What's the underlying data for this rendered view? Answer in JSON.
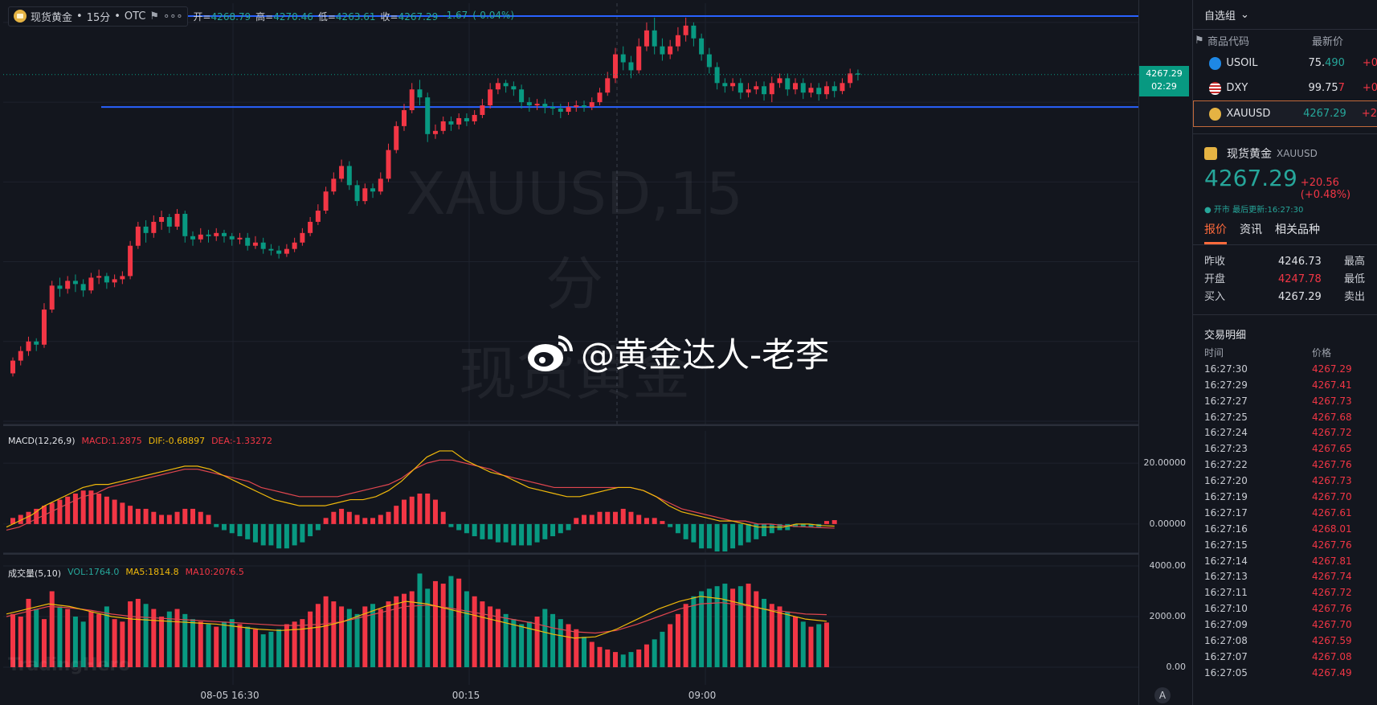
{
  "legend": {
    "symbol": "现货黄金",
    "interval": "15分",
    "exchange": "OTC",
    "more": "∘∘∘",
    "open_label": "开=",
    "open": "4268.79",
    "high_label": "高=",
    "high": "4270.46",
    "low_label": "低=",
    "low": "4263.61",
    "close_label": "收=",
    "close": "4267.29",
    "change": "-1.67",
    "change_pct": "(-0.04%)"
  },
  "price_tag": {
    "price": "4267.29",
    "countdown": "02:29"
  },
  "watermark": {
    "line1": "XAUUSD,15分",
    "line2": "现货黄金"
  },
  "weibo": {
    "handle": "@黄金达人-老李"
  },
  "brand": "TradingHero",
  "macd": {
    "title": "MACD(12,26,9)",
    "macd": "MACD:1.2875",
    "dif": "DIF:-0.68897",
    "dea": "DEA:-1.33272"
  },
  "vol": {
    "title": "成交量(5,10)",
    "vol": "VOL:1764.0",
    "ma5": "MA5:1814.8",
    "ma10": "MA10:2076.5"
  },
  "time_axis": [
    "08-05 16:30",
    "00:15",
    "09:00"
  ],
  "axis_button": "A",
  "watchlist": {
    "title": "自选组",
    "col_code": "商品代码",
    "col_price": "最新价",
    "rows": [
      {
        "code": "USOIL",
        "price_main": "75.",
        "price_tail": "490",
        "chg": "+0"
      },
      {
        "code": "DXY",
        "price_main": "99.75",
        "price_tail": "7",
        "chg": "+0"
      },
      {
        "code": "XAUUSD",
        "price_main": "4267.29",
        "price_tail": "",
        "chg": "+2"
      }
    ]
  },
  "symbol_info": {
    "name": "现货黄金",
    "code": "XAUUSD",
    "price": "4267.29",
    "change": "+20.56 (+0.48%)",
    "status": "● 开市 最后更新:16:27:30"
  },
  "tabs": [
    "报价",
    "资讯",
    "相关品种"
  ],
  "quotes": [
    {
      "label": "昨收",
      "value": "4246.73",
      "label2": "最高"
    },
    {
      "label": "开盘",
      "value": "4247.78",
      "label2": "最低"
    },
    {
      "label": "买入",
      "value": "4267.29",
      "label2": "卖出"
    }
  ],
  "trades": {
    "title": "交易明细",
    "col_time": "时间",
    "col_price": "价格",
    "rows": [
      [
        "16:27:30",
        "4267.29"
      ],
      [
        "16:27:29",
        "4267.41"
      ],
      [
        "16:27:27",
        "4267.73"
      ],
      [
        "16:27:25",
        "4267.68"
      ],
      [
        "16:27:24",
        "4267.72"
      ],
      [
        "16:27:23",
        "4267.65"
      ],
      [
        "16:27:22",
        "4267.76"
      ],
      [
        "16:27:20",
        "4267.73"
      ],
      [
        "16:27:19",
        "4267.70"
      ],
      [
        "16:27:17",
        "4267.61"
      ],
      [
        "16:27:16",
        "4268.01"
      ],
      [
        "16:27:15",
        "4267.76"
      ],
      [
        "16:27:14",
        "4267.81"
      ],
      [
        "16:27:13",
        "4267.74"
      ],
      [
        "16:27:11",
        "4267.72"
      ],
      [
        "16:27:10",
        "4267.76"
      ],
      [
        "16:27:09",
        "4267.70"
      ],
      [
        "16:27:08",
        "4267.59"
      ],
      [
        "16:27:07",
        "4267.08"
      ],
      [
        "16:27:05",
        "4267.49"
      ]
    ]
  },
  "chart_data": [
    {
      "type": "candlestick",
      "y_ticks": [
        "4300.00",
        "4250.00",
        "4200.00",
        "4150.00",
        "4100.00",
        "4050.00"
      ],
      "ylim": [
        4050,
        4307
      ],
      "horizontal_lines": [
        4304,
        4247
      ],
      "candles": [
        [
          4080,
          4088,
          4078,
          4090
        ],
        [
          4088,
          4094,
          4085,
          4097
        ],
        [
          4094,
          4100,
          4091,
          4103
        ],
        [
          4100,
          4098,
          4094,
          4102
        ],
        [
          4098,
          4120,
          4096,
          4124
        ],
        [
          4120,
          4135,
          4118,
          4138
        ],
        [
          4135,
          4133,
          4128,
          4140
        ],
        [
          4133,
          4138,
          4130,
          4141
        ],
        [
          4138,
          4136,
          4131,
          4142
        ],
        [
          4136,
          4132,
          4128,
          4139
        ],
        [
          4132,
          4140,
          4130,
          4143
        ],
        [
          4140,
          4141,
          4136,
          4145
        ],
        [
          4141,
          4137,
          4133,
          4143
        ],
        [
          4137,
          4139,
          4134,
          4142
        ],
        [
          4139,
          4141,
          4136,
          4144
        ],
        [
          4141,
          4160,
          4139,
          4163
        ],
        [
          4160,
          4172,
          4158,
          4175
        ],
        [
          4172,
          4168,
          4162,
          4176
        ],
        [
          4168,
          4175,
          4165,
          4179
        ],
        [
          4175,
          4178,
          4170,
          4182
        ],
        [
          4178,
          4172,
          4168,
          4180
        ],
        [
          4172,
          4180,
          4170,
          4183
        ],
        [
          4180,
          4166,
          4162,
          4182
        ],
        [
          4166,
          4164,
          4160,
          4169
        ],
        [
          4164,
          4167,
          4162,
          4171
        ],
        [
          4167,
          4166,
          4162,
          4170
        ],
        [
          4166,
          4168,
          4163,
          4171
        ],
        [
          4168,
          4166,
          4162,
          4170
        ],
        [
          4166,
          4164,
          4160,
          4168
        ],
        [
          4164,
          4165,
          4161,
          4168
        ],
        [
          4165,
          4160,
          4157,
          4168
        ],
        [
          4160,
          4162,
          4158,
          4166
        ],
        [
          4162,
          4158,
          4155,
          4165
        ],
        [
          4158,
          4157,
          4154,
          4161
        ],
        [
          4157,
          4155,
          4152,
          4160
        ],
        [
          4155,
          4158,
          4153,
          4161
        ],
        [
          4158,
          4162,
          4156,
          4165
        ],
        [
          4162,
          4168,
          4160,
          4171
        ],
        [
          4168,
          4175,
          4166,
          4178
        ],
        [
          4175,
          4182,
          4173,
          4186
        ],
        [
          4182,
          4194,
          4180,
          4197
        ],
        [
          4194,
          4202,
          4192,
          4206
        ],
        [
          4202,
          4210,
          4200,
          4214
        ],
        [
          4210,
          4198,
          4195,
          4213
        ],
        [
          4198,
          4188,
          4185,
          4201
        ],
        [
          4188,
          4196,
          4186,
          4199
        ],
        [
          4196,
          4194,
          4190,
          4199
        ],
        [
          4194,
          4202,
          4192,
          4206
        ],
        [
          4202,
          4220,
          4200,
          4224
        ],
        [
          4220,
          4235,
          4218,
          4238
        ],
        [
          4235,
          4245,
          4232,
          4249
        ],
        [
          4245,
          4258,
          4243,
          4262
        ],
        [
          4258,
          4253,
          4248,
          4264
        ],
        [
          4253,
          4230,
          4225,
          4256
        ],
        [
          4230,
          4232,
          4227,
          4236
        ],
        [
          4232,
          4238,
          4230,
          4241
        ],
        [
          4238,
          4236,
          4232,
          4241
        ],
        [
          4236,
          4240,
          4233,
          4243
        ],
        [
          4240,
          4238,
          4235,
          4243
        ],
        [
          4238,
          4242,
          4236,
          4245
        ],
        [
          4242,
          4248,
          4240,
          4252
        ],
        [
          4248,
          4258,
          4246,
          4262
        ],
        [
          4258,
          4262,
          4255,
          4265
        ],
        [
          4262,
          4260,
          4256,
          4264
        ],
        [
          4260,
          4258,
          4254,
          4263
        ],
        [
          4258,
          4250,
          4246,
          4261
        ],
        [
          4250,
          4248,
          4244,
          4253
        ],
        [
          4248,
          4249,
          4245,
          4252
        ],
        [
          4249,
          4247,
          4243,
          4252
        ],
        [
          4247,
          4246,
          4242,
          4250
        ],
        [
          4246,
          4244,
          4240,
          4249
        ],
        [
          4244,
          4247,
          4242,
          4250
        ],
        [
          4247,
          4248,
          4244,
          4251
        ],
        [
          4248,
          4247,
          4244,
          4251
        ],
        [
          4247,
          4250,
          4245,
          4253
        ],
        [
          4250,
          4256,
          4248,
          4259
        ],
        [
          4256,
          4265,
          4254,
          4269
        ],
        [
          4265,
          4280,
          4262,
          4284
        ],
        [
          4280,
          4275,
          4270,
          4285
        ],
        [
          4275,
          4270,
          4265,
          4279
        ],
        [
          4270,
          4285,
          4268,
          4290
        ],
        [
          4285,
          4295,
          4282,
          4300
        ],
        [
          4295,
          4285,
          4280,
          4303
        ],
        [
          4285,
          4280,
          4276,
          4290
        ],
        [
          4280,
          4285,
          4277,
          4289
        ],
        [
          4285,
          4292,
          4282,
          4297
        ],
        [
          4292,
          4298,
          4288,
          4303
        ],
        [
          4298,
          4290,
          4285,
          4300
        ],
        [
          4290,
          4280,
          4276,
          4293
        ],
        [
          4280,
          4272,
          4268,
          4284
        ],
        [
          4272,
          4262,
          4258,
          4275
        ],
        [
          4262,
          4260,
          4256,
          4265
        ],
        [
          4260,
          4262,
          4257,
          4265
        ],
        [
          4262,
          4256,
          4252,
          4265
        ],
        [
          4256,
          4258,
          4253,
          4262
        ],
        [
          4258,
          4260,
          4255,
          4263
        ],
        [
          4260,
          4255,
          4251,
          4263
        ],
        [
          4255,
          4262,
          4250,
          4266
        ],
        [
          4262,
          4265,
          4259,
          4268
        ],
        [
          4265,
          4258,
          4254,
          4268
        ],
        [
          4258,
          4262,
          4255,
          4265
        ],
        [
          4262,
          4256,
          4252,
          4265
        ],
        [
          4256,
          4259,
          4253,
          4262
        ],
        [
          4259,
          4255,
          4251,
          4262
        ],
        [
          4255,
          4260,
          4252,
          4263
        ],
        [
          4260,
          4257,
          4253,
          4263
        ],
        [
          4257,
          4262,
          4255,
          4265
        ],
        [
          4262,
          4268,
          4259,
          4271
        ],
        [
          4268,
          4267.29,
          4263.61,
          4270.46
        ]
      ]
    },
    {
      "type": "bar",
      "title": "MACD(12,26,9)",
      "y_ticks": [
        "20.00000",
        "0.00000"
      ],
      "ylim": [
        -9,
        29
      ],
      "histogram": [
        2,
        3,
        4,
        5,
        6,
        7,
        8,
        9,
        10,
        11,
        11,
        10,
        9,
        8,
        7,
        6,
        5,
        5,
        4,
        3,
        3,
        4,
        5,
        5,
        4,
        3,
        -1,
        -2,
        -3,
        -4,
        -5,
        -6,
        -7,
        -7,
        -8,
        -8,
        -7,
        -6,
        -4,
        -2,
        2,
        4,
        5,
        4,
        3,
        2,
        2,
        3,
        4,
        6,
        8,
        9,
        10,
        10,
        8,
        4,
        -1,
        -2,
        -3,
        -4,
        -5,
        -5,
        -6,
        -6,
        -7,
        -7,
        -7,
        -6,
        -5,
        -4,
        -3,
        -2,
        2,
        3,
        3,
        4,
        4,
        4,
        5,
        4,
        3,
        2,
        2,
        1,
        -1,
        -3,
        -5,
        -6,
        -8,
        -8,
        -9,
        -9,
        -8,
        -7,
        -6,
        -5,
        -4,
        -3,
        -2,
        -2,
        -1,
        -1,
        -1,
        -1,
        1,
        1.2875
      ],
      "dif": [
        -1,
        1,
        3,
        6,
        8,
        10,
        12,
        13,
        13,
        14,
        15,
        16,
        17,
        18,
        19,
        19,
        18,
        16,
        14,
        12,
        10,
        8,
        7,
        6,
        6,
        6,
        7,
        8,
        8,
        9,
        11,
        14,
        18,
        22,
        24,
        24,
        21,
        19,
        17,
        16,
        14,
        12,
        11,
        10,
        9,
        9,
        10,
        11,
        12,
        12,
        11,
        9,
        6,
        4,
        3,
        2,
        1,
        1,
        0,
        -1,
        -1,
        -1,
        0,
        0,
        -0.5,
        -0.68897
      ],
      "dea": [
        -2,
        -1,
        1,
        3,
        5,
        7,
        9,
        10,
        12,
        13,
        14,
        15,
        16,
        17,
        18,
        18,
        17,
        16,
        15,
        14,
        12,
        11,
        10,
        9,
        9,
        9,
        9,
        10,
        11,
        12,
        13,
        15,
        18,
        20,
        21,
        21,
        20,
        19,
        18,
        16,
        15,
        14,
        13,
        12,
        12,
        12,
        12,
        12,
        12,
        12,
        11,
        9,
        7,
        5,
        4,
        3,
        2,
        1,
        1,
        0,
        0,
        -0.5,
        -0.8,
        -1,
        -1.2,
        -1.33272
      ]
    },
    {
      "type": "bar",
      "title": "成交量(5,10)",
      "y_ticks": [
        "4000.00",
        "2000.00",
        "0.00"
      ],
      "ylim": [
        0,
        4000
      ],
      "volumes": [
        2100,
        2000,
        2700,
        2300,
        1900,
        3000,
        2400,
        2300,
        2000,
        1800,
        2200,
        2100,
        2400,
        1900,
        1800,
        2600,
        2700,
        2500,
        2300,
        2000,
        2200,
        2300,
        2100,
        1900,
        1800,
        1700,
        1600,
        1800,
        1900,
        1700,
        1600,
        1500,
        1300,
        1400,
        1500,
        1700,
        1800,
        1900,
        2200,
        2500,
        2800,
        2600,
        2400,
        2300,
        2100,
        2400,
        2500,
        2300,
        2600,
        2800,
        2900,
        3000,
        3700,
        3100,
        3400,
        3300,
        3600,
        3500,
        3000,
        2800,
        2600,
        2400,
        2300,
        2100,
        1900,
        1700,
        1800,
        2000,
        2300,
        2100,
        1900,
        1700,
        1500,
        1200,
        1000,
        800,
        700,
        600,
        500,
        600,
        700,
        900,
        1100,
        1400,
        1700,
        2100,
        2500,
        2800,
        3000,
        3100,
        3200,
        3300,
        3100,
        3200,
        3300,
        3000,
        2700,
        2500,
        2400,
        2200,
        2000,
        1800,
        1600,
        1700,
        1764
      ],
      "ma5": [
        2100,
        2300,
        2500,
        2400,
        2200,
        2000,
        1900,
        1850,
        1800,
        1750,
        1700,
        1600,
        1500,
        1450,
        1500,
        1600,
        1800,
        2100,
        2400,
        2600,
        2500,
        2300,
        2100,
        1900,
        1700,
        1500,
        1300,
        1150,
        1200,
        1500,
        1900,
        2300,
        2600,
        2800,
        2700,
        2500,
        2300,
        2100,
        1900,
        1814.8
      ],
      "ma10": [
        2000,
        2200,
        2400,
        2350,
        2250,
        2100,
        2000,
        1950,
        1900,
        1850,
        1800,
        1750,
        1700,
        1650,
        1650,
        1700,
        1800,
        2000,
        2200,
        2400,
        2450,
        2350,
        2200,
        2050,
        1900,
        1750,
        1550,
        1400,
        1350,
        1450,
        1700,
        2000,
        2300,
        2500,
        2550,
        2450,
        2300,
        2200,
        2100,
        2076.5
      ]
    }
  ]
}
